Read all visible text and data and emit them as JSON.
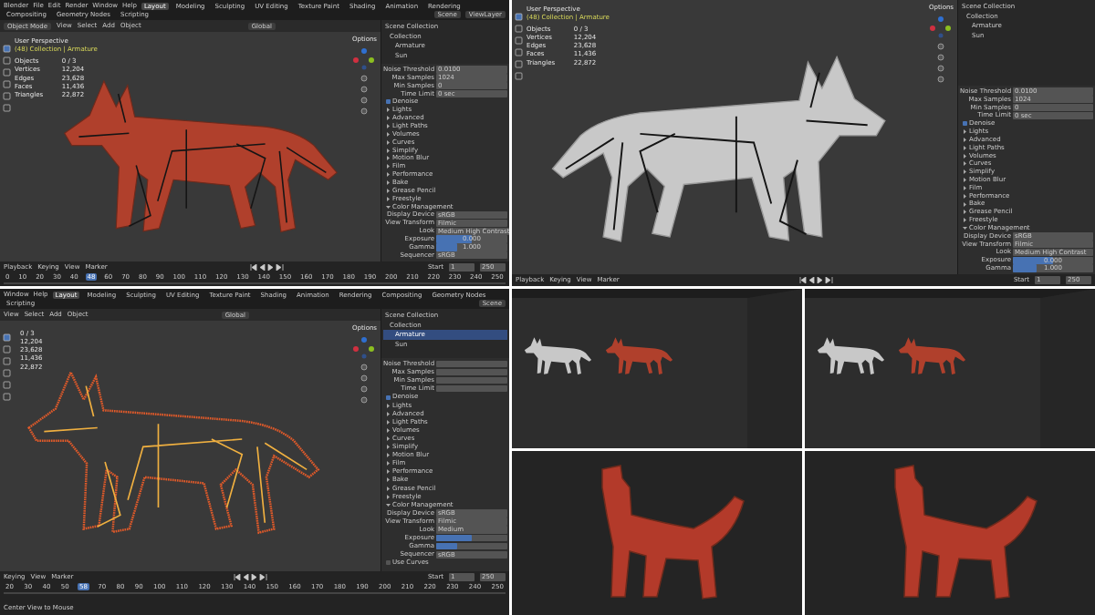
{
  "panels": [
    {
      "kind": "textured",
      "app_title": "Blender",
      "menus": [
        "File",
        "Edit",
        "Render",
        "Window",
        "Help"
      ],
      "workspaces": [
        {
          "label": "Layout",
          "selected": true
        },
        {
          "label": "Modeling",
          "selected": false
        },
        {
          "label": "Sculpting",
          "selected": false
        },
        {
          "label": "UV Editing",
          "selected": false
        },
        {
          "label": "Texture Paint",
          "selected": false
        },
        {
          "label": "Shading",
          "selected": false
        },
        {
          "label": "Animation",
          "selected": false
        },
        {
          "label": "Rendering",
          "selected": false
        },
        {
          "label": "Compositing",
          "selected": false
        },
        {
          "label": "Geometry Nodes",
          "selected": false
        },
        {
          "label": "Scripting",
          "selected": false
        }
      ],
      "scene": "Scene",
      "view_layer": "ViewLayer",
      "mode": "Object Mode",
      "header_menus": [
        "View",
        "Select",
        "Add",
        "Object"
      ],
      "orientation": "Global",
      "options": "Options",
      "overlay_title": "User Perspective",
      "overlay_subtitle": "(48) Collection | Armature",
      "stats": [
        {
          "label": "Objects",
          "value": "0 / 3"
        },
        {
          "label": "Vertices",
          "value": "12,204"
        },
        {
          "label": "Edges",
          "value": "23,628"
        },
        {
          "label": "Faces",
          "value": "11,436"
        },
        {
          "label": "Triangles",
          "value": "22,872"
        }
      ],
      "outliner": [
        {
          "label": "Scene Collection",
          "selected": false,
          "children": [
            {
              "label": "Collection",
              "selected": false,
              "children": [
                {
                  "label": "Armature",
                  "selected": false
                },
                {
                  "label": "Sun",
                  "selected": false
                }
              ]
            }
          ]
        }
      ],
      "properties": [
        {
          "kind": "field",
          "label": "Noise Threshold",
          "value": "0.0100"
        },
        {
          "kind": "field",
          "label": "Max Samples",
          "value": "1024"
        },
        {
          "kind": "field",
          "label": "Min Samples",
          "value": "0"
        },
        {
          "kind": "field",
          "label": "Time Limit",
          "value": "0 sec"
        },
        {
          "kind": "check",
          "label": "Denoise",
          "checked": true
        },
        {
          "kind": "section",
          "label": "Lights",
          "expanded": false
        },
        {
          "kind": "section",
          "label": "Advanced",
          "expanded": false
        },
        {
          "kind": "section",
          "label": "Light Paths",
          "expanded": false
        },
        {
          "kind": "section",
          "label": "Volumes",
          "expanded": false
        },
        {
          "kind": "section",
          "label": "Curves",
          "expanded": false
        },
        {
          "kind": "section",
          "label": "Simplify",
          "expanded": false
        },
        {
          "kind": "section",
          "label": "Motion Blur",
          "expanded": false
        },
        {
          "kind": "section",
          "label": "Film",
          "expanded": false
        },
        {
          "kind": "section",
          "label": "Performance",
          "expanded": false
        },
        {
          "kind": "section",
          "label": "Bake",
          "expanded": false
        },
        {
          "kind": "section",
          "label": "Grease Pencil",
          "expanded": false
        },
        {
          "kind": "section",
          "label": "Freestyle",
          "expanded": false
        },
        {
          "kind": "section",
          "label": "Color Management",
          "expanded": true
        },
        {
          "kind": "field",
          "label": "Display Device",
          "value": "sRGB"
        },
        {
          "kind": "field",
          "label": "View Transform",
          "value": "Filmic"
        },
        {
          "kind": "field",
          "label": "Look",
          "value": "Medium High Contrast"
        },
        {
          "kind": "slider",
          "label": "Exposure",
          "value": "0.000",
          "level": 0.5
        },
        {
          "kind": "slider",
          "label": "Gamma",
          "value": "1.000",
          "level": 0.3
        },
        {
          "kind": "field",
          "label": "Sequencer",
          "value": "sRGB"
        }
      ],
      "timeline_menus": [
        "Playback",
        "Keying",
        "View",
        "Marker"
      ],
      "start_label": "Start",
      "start": "1",
      "end": "250",
      "frames": [
        {
          "label": "0",
          "selected": false
        },
        {
          "label": "10",
          "selected": false
        },
        {
          "label": "20",
          "selected": false
        },
        {
          "label": "30",
          "selected": false
        },
        {
          "label": "40",
          "selected": false
        },
        {
          "label": "48",
          "selected": true
        },
        {
          "label": "60",
          "selected": false
        },
        {
          "label": "70",
          "selected": false
        },
        {
          "label": "80",
          "selected": false
        },
        {
          "label": "90",
          "selected": false
        },
        {
          "label": "100",
          "selected": false
        },
        {
          "label": "110",
          "selected": false
        },
        {
          "label": "120",
          "selected": false
        },
        {
          "label": "130",
          "selected": false
        },
        {
          "label": "140",
          "selected": false
        },
        {
          "label": "150",
          "selected": false
        },
        {
          "label": "160",
          "selected": false
        },
        {
          "label": "170",
          "selected": false
        },
        {
          "label": "180",
          "selected": false
        },
        {
          "label": "190",
          "selected": false
        },
        {
          "label": "200",
          "selected": false
        },
        {
          "label": "210",
          "selected": false
        },
        {
          "label": "220",
          "selected": false
        },
        {
          "label": "230",
          "selected": false
        },
        {
          "label": "240",
          "selected": false
        },
        {
          "label": "250",
          "selected": false
        }
      ]
    },
    {
      "kind": "solid",
      "overlay_title": "User Perspective",
      "overlay_subtitle": "(48) Collection | Armature",
      "options": "Options",
      "stats": [
        {
          "label": "Objects",
          "value": "0 / 3"
        },
        {
          "label": "Vertices",
          "value": "12,204"
        },
        {
          "label": "Edges",
          "value": "23,628"
        },
        {
          "label": "Faces",
          "value": "11,436"
        },
        {
          "label": "Triangles",
          "value": "22,872"
        }
      ],
      "outliner": [
        {
          "label": "Scene Collection",
          "selected": false,
          "children": [
            {
              "label": "Collection",
              "selected": false,
              "children": [
                {
                  "label": "Armature",
                  "selected": false
                },
                {
                  "label": "Sun",
                  "selected": false
                }
              ]
            }
          ]
        }
      ],
      "properties": [
        {
          "kind": "field",
          "label": "Noise Threshold",
          "value": "0.0100"
        },
        {
          "kind": "field",
          "label": "Max Samples",
          "value": "1024"
        },
        {
          "kind": "field",
          "label": "Min Samples",
          "value": "0"
        },
        {
          "kind": "field",
          "label": "Time Limit",
          "value": "0 sec"
        },
        {
          "kind": "check",
          "label": "Denoise",
          "checked": true
        },
        {
          "kind": "section",
          "label": "Lights",
          "expanded": false
        },
        {
          "kind": "section",
          "label": "Advanced",
          "expanded": false
        },
        {
          "kind": "section",
          "label": "Light Paths",
          "expanded": false
        },
        {
          "kind": "section",
          "label": "Volumes",
          "expanded": false
        },
        {
          "kind": "section",
          "label": "Curves",
          "expanded": false
        },
        {
          "kind": "section",
          "label": "Simplify",
          "expanded": false
        },
        {
          "kind": "section",
          "label": "Motion Blur",
          "expanded": false
        },
        {
          "kind": "section",
          "label": "Film",
          "expanded": false
        },
        {
          "kind": "section",
          "label": "Performance",
          "expanded": false
        },
        {
          "kind": "section",
          "label": "Bake",
          "expanded": false
        },
        {
          "kind": "section",
          "label": "Grease Pencil",
          "expanded": false
        },
        {
          "kind": "section",
          "label": "Freestyle",
          "expanded": false
        },
        {
          "kind": "section",
          "label": "Color Management",
          "expanded": true
        },
        {
          "kind": "field",
          "label": "Display Device",
          "value": "sRGB"
        },
        {
          "kind": "field",
          "label": "View Transform",
          "value": "Filmic"
        },
        {
          "kind": "field",
          "label": "Look",
          "value": "Medium High Contrast"
        },
        {
          "kind": "slider",
          "label": "Exposure",
          "value": "0.000",
          "level": 0.5
        },
        {
          "kind": "slider",
          "label": "Gamma",
          "value": "1.000",
          "level": 0.3
        }
      ],
      "timeline_menus": [
        "Playback",
        "Keying",
        "View",
        "Marker"
      ],
      "start_label": "Start",
      "start": "1",
      "end": "250"
    },
    {
      "kind": "wireframe",
      "menus": [
        "Window",
        "Help"
      ],
      "workspaces": [
        {
          "label": "Layout",
          "selected": true
        },
        {
          "label": "Modeling",
          "selected": false
        },
        {
          "label": "Sculpting",
          "selected": false
        },
        {
          "label": "UV Editing",
          "selected": false
        },
        {
          "label": "Texture Paint",
          "selected": false
        },
        {
          "label": "Shading",
          "selected": false
        },
        {
          "label": "Animation",
          "selected": false
        },
        {
          "label": "Rendering",
          "selected": false
        },
        {
          "label": "Compositing",
          "selected": false
        },
        {
          "label": "Geometry Nodes",
          "selected": false
        },
        {
          "label": "Scripting",
          "selected": false
        }
      ],
      "scene": "Scene",
      "header_menus": [
        "View",
        "Select",
        "Add",
        "Object"
      ],
      "orientation": "Global",
      "options": "Options",
      "stats": [
        {
          "value": "0 / 3"
        },
        {
          "value": "12,204"
        },
        {
          "value": "23,628"
        },
        {
          "value": "11,436"
        },
        {
          "value": "22,872"
        }
      ],
      "outliner": [
        {
          "label": "Scene Collection",
          "selected": false,
          "children": [
            {
              "label": "Collection",
              "selected": false,
              "children": [
                {
                  "label": "Armature",
                  "selected": true
                },
                {
                  "label": "Sun",
                  "selected": false
                }
              ]
            }
          ]
        }
      ],
      "properties": [
        {
          "kind": "field",
          "label": "Noise Threshold"
        },
        {
          "kind": "field",
          "label": "Max Samples"
        },
        {
          "kind": "field",
          "label": "Min Samples"
        },
        {
          "kind": "field",
          "label": "Time Limit"
        },
        {
          "kind": "check",
          "label": "Denoise",
          "checked": true
        },
        {
          "kind": "section",
          "label": "Lights",
          "expanded": false
        },
        {
          "kind": "section",
          "label": "Advanced",
          "expanded": false
        },
        {
          "kind": "section",
          "label": "Light Paths",
          "expanded": false
        },
        {
          "kind": "section",
          "label": "Volumes",
          "expanded": false
        },
        {
          "kind": "section",
          "label": "Curves",
          "expanded": false
        },
        {
          "kind": "section",
          "label": "Simplify",
          "expanded": false
        },
        {
          "kind": "section",
          "label": "Motion Blur",
          "expanded": false
        },
        {
          "kind": "section",
          "label": "Film",
          "expanded": false
        },
        {
          "kind": "section",
          "label": "Performance",
          "expanded": false
        },
        {
          "kind": "section",
          "label": "Bake",
          "expanded": false
        },
        {
          "kind": "section",
          "label": "Grease Pencil",
          "expanded": false
        },
        {
          "kind": "section",
          "label": "Freestyle",
          "expanded": false
        },
        {
          "kind": "section",
          "label": "Color Management",
          "expanded": true
        },
        {
          "kind": "field",
          "label": "Display Device",
          "value": "sRGB"
        },
        {
          "kind": "field",
          "label": "View Transform",
          "value": "Filmic"
        },
        {
          "kind": "field",
          "label": "Look",
          "value": "Medium"
        },
        {
          "kind": "slider",
          "label": "Exposure",
          "level": 0.5
        },
        {
          "kind": "slider",
          "label": "Gamma",
          "level": 0.3
        },
        {
          "kind": "field",
          "label": "Sequencer",
          "value": "sRGB"
        },
        {
          "kind": "check",
          "label": "Use Curves",
          "checked": false
        }
      ],
      "timeline_menus": [
        "Keying",
        "View",
        "Marker"
      ],
      "start_label": "Start",
      "start": "1",
      "end": "250",
      "status": "Center View to Mouse",
      "frames": [
        {
          "label": "20",
          "selected": false
        },
        {
          "label": "30",
          "selected": false
        },
        {
          "label": "40",
          "selected": false
        },
        {
          "label": "50",
          "selected": false
        },
        {
          "label": "58",
          "selected": true
        },
        {
          "label": "70",
          "selected": false
        },
        {
          "label": "80",
          "selected": false
        },
        {
          "label": "90",
          "selected": false
        },
        {
          "label": "100",
          "selected": false
        },
        {
          "label": "110",
          "selected": false
        },
        {
          "label": "120",
          "selected": false
        },
        {
          "label": "130",
          "selected": false
        },
        {
          "label": "140",
          "selected": false
        },
        {
          "label": "150",
          "selected": false
        },
        {
          "label": "160",
          "selected": false
        },
        {
          "label": "170",
          "selected": false
        },
        {
          "label": "180",
          "selected": false
        },
        {
          "label": "190",
          "selected": false
        },
        {
          "label": "200",
          "selected": false
        },
        {
          "label": "210",
          "selected": false
        },
        {
          "label": "220",
          "selected": false
        },
        {
          "label": "230",
          "selected": false
        },
        {
          "label": "240",
          "selected": false
        },
        {
          "label": "250",
          "selected": false
        }
      ]
    }
  ],
  "tiles": [
    {
      "kind": "screenshot"
    },
    {
      "kind": "screenshot"
    },
    {
      "kind": "render"
    },
    {
      "kind": "render"
    }
  ]
}
